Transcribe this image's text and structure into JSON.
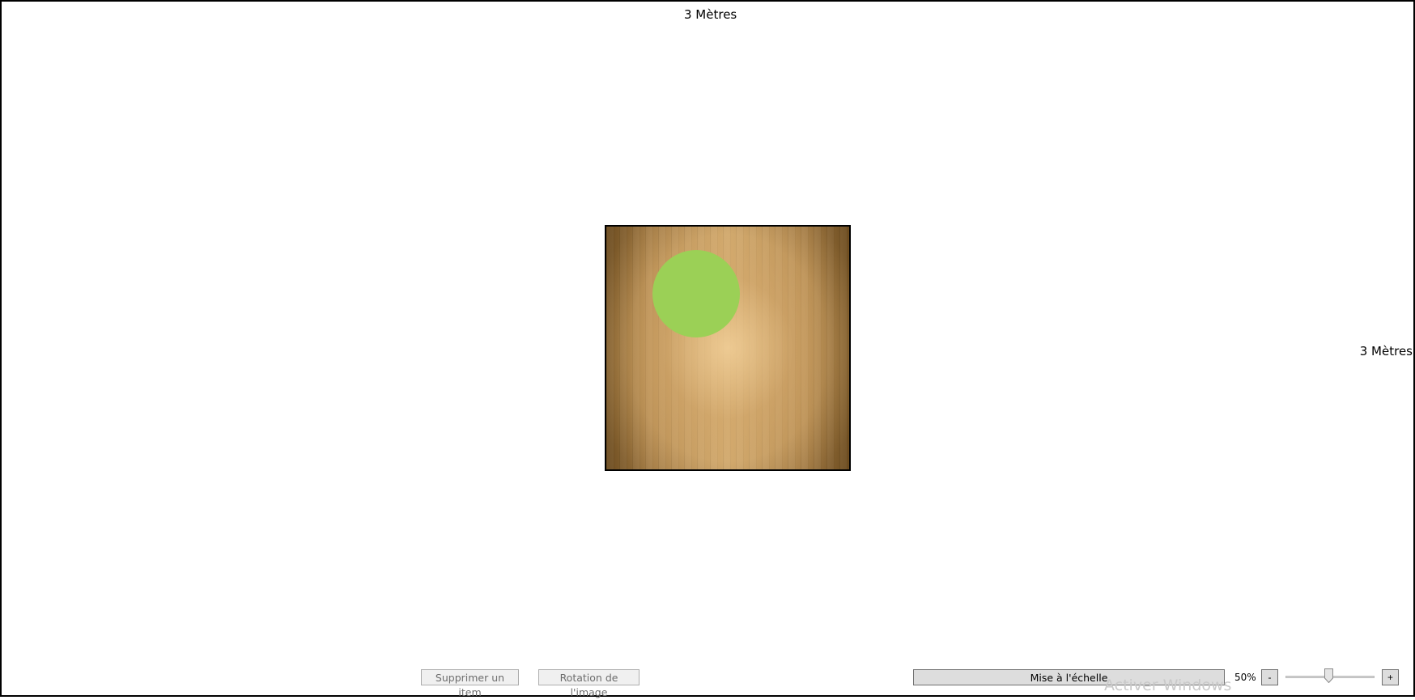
{
  "dimensions": {
    "top_label": "3 Mètres",
    "right_label": "3 Mètres"
  },
  "canvas": {
    "floor_texture": "wood-floor",
    "item_color": "#9bd056"
  },
  "toolbar": {
    "delete_label": "Supprimer un item",
    "rotate_label": "Rotation de l'image",
    "scale_label": "Mise à l'échelle",
    "zoom_value": "50%",
    "zoom_minus": "-",
    "zoom_plus": "+",
    "zoom_slider_level": 0.5
  },
  "watermark": {
    "text": "Activer Windows"
  }
}
